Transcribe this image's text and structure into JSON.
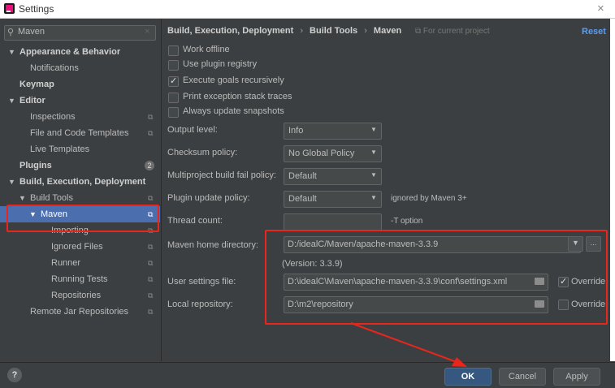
{
  "window": {
    "title": "Settings",
    "close_glyph": "×"
  },
  "search": {
    "value": "Maven",
    "icon": "search-icon",
    "clear_glyph": "×"
  },
  "tree": {
    "appearance": "Appearance & Behavior",
    "notifications": "Notifications",
    "keymap": "Keymap",
    "editor": "Editor",
    "inspections": "Inspections",
    "file_templates": "File and Code Templates",
    "live_templates": "Live Templates",
    "plugins": "Plugins",
    "plugins_badge": "2",
    "build": "Build, Execution, Deployment",
    "build_tools": "Build Tools",
    "maven": "Maven",
    "importing": "Importing",
    "ignored_files": "Ignored Files",
    "runner": "Runner",
    "running_tests": "Running Tests",
    "repositories": "Repositories",
    "remote_jar": "Remote Jar Repositories"
  },
  "header": {
    "crumb1": "Build, Execution, Deployment",
    "sep1": "›",
    "crumb2": "Build Tools",
    "sep2": "›",
    "crumb3": "Maven",
    "scope": "⧉ For current project",
    "reset": "Reset"
  },
  "checkboxes": [
    {
      "label": "Work offline",
      "checked": false
    },
    {
      "label": "Use plugin registry",
      "checked": false
    },
    {
      "label": "Execute goals recursively",
      "checked": true
    },
    {
      "label": "Print exception stack traces",
      "checked": false
    },
    {
      "label": "Always update snapshots",
      "checked": false
    }
  ],
  "fields": {
    "output_level": {
      "label": "Output level:",
      "value": "Info"
    },
    "checksum": {
      "label": "Checksum policy:",
      "value": "No Global Policy"
    },
    "multiproject": {
      "label": "Multiproject build fail policy:",
      "value": "Default"
    },
    "plugin_update": {
      "label": "Plugin update policy:",
      "value": "Default",
      "hint": "ignored by Maven 3+"
    },
    "thread_count": {
      "label": "Thread count:",
      "value": "",
      "hint": "-T option"
    },
    "maven_home": {
      "label": "Maven home directory:",
      "value": "D:/idealC/Maven/apache-maven-3.3.9",
      "version": "(Version: 3.3.9)"
    },
    "user_settings": {
      "label": "User settings file:",
      "value": "D:\\idealC\\Maven\\apache-maven-3.3.9\\conf\\settings.xml",
      "override": "Override",
      "override_checked": true
    },
    "local_repo": {
      "label": "Local repository:",
      "value": "D:\\m2\\repository",
      "override": "Override",
      "override_checked": false
    }
  },
  "footer": {
    "help": "?",
    "ok": "OK",
    "cancel": "Cancel",
    "apply": "Apply"
  },
  "colors": {
    "selection": "#4b6eaf",
    "annotation": "#e8261c",
    "ok_button": "#365880",
    "link": "#589df6"
  }
}
